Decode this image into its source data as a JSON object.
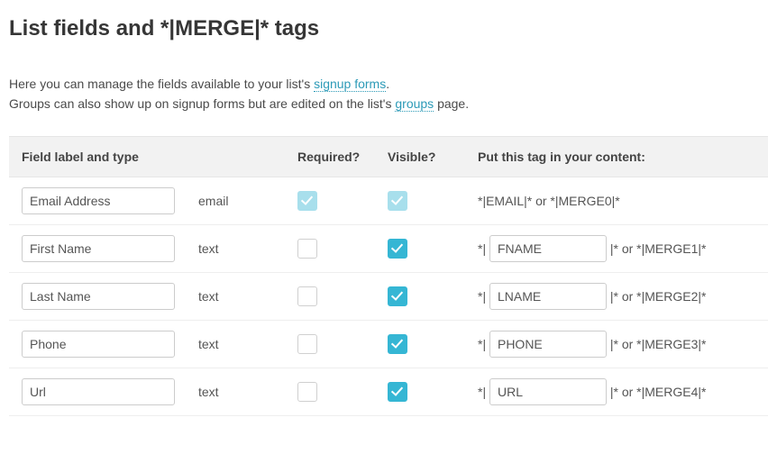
{
  "title": "List fields and *|MERGE|* tags",
  "intro": {
    "line1_pre": "Here you can manage the fields available to your list's ",
    "link1": "signup forms",
    "line1_post": ".",
    "line2_pre": "Groups can also show up on signup forms but are edited on the list's ",
    "link2": "groups",
    "line2_post": " page."
  },
  "headers": {
    "label": "Field label and type",
    "required": "Required?",
    "visible": "Visible?",
    "tag": "Put this tag in your content:"
  },
  "sep": {
    "star_pipe": "*|",
    "pipe_star_or": "|* or *|",
    "pipe_star": "|*"
  },
  "rows": [
    {
      "label": "Email Address",
      "type": "email",
      "required": true,
      "required_locked": true,
      "visible": true,
      "visible_locked": true,
      "tag_static": "*|EMAIL|* or *|MERGE0|*"
    },
    {
      "label": "First Name",
      "type": "text",
      "required": false,
      "visible": true,
      "tag": "FNAME",
      "merge": "MERGE1"
    },
    {
      "label": "Last Name",
      "type": "text",
      "required": false,
      "visible": true,
      "tag": "LNAME",
      "merge": "MERGE2"
    },
    {
      "label": "Phone",
      "type": "text",
      "required": false,
      "visible": true,
      "tag": "PHONE",
      "merge": "MERGE3"
    },
    {
      "label": "Url",
      "type": "text",
      "required": false,
      "visible": true,
      "tag": "URL",
      "merge": "MERGE4"
    }
  ]
}
